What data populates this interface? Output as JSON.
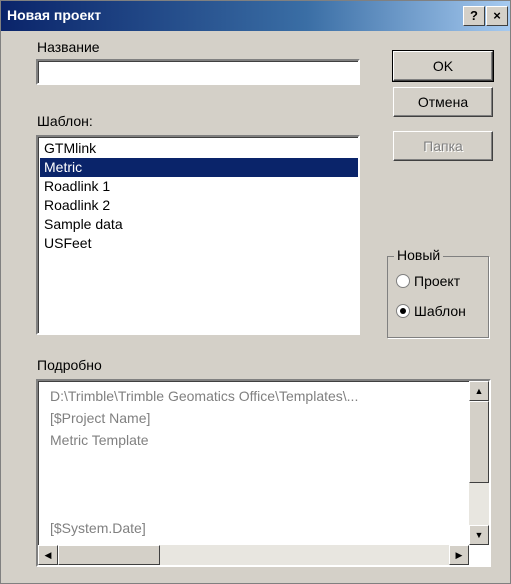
{
  "window": {
    "title": "Новая проект"
  },
  "titlebar_buttons": {
    "help": "?",
    "close": "×"
  },
  "name_label": "Название",
  "name_value": "",
  "template_label": "Шаблон:",
  "templates": [
    "GTMlink",
    "Metric",
    "Roadlink 1",
    "Roadlink 2",
    "Sample data",
    "USFeet"
  ],
  "buttons": {
    "ok": "OK",
    "cancel": "Отмена",
    "folder": "Папка"
  },
  "new_group": {
    "legend": "Новый",
    "options": [
      "Проект",
      "Шаблон"
    ],
    "selected": "Шаблон"
  },
  "details": {
    "label": "Подробно",
    "lines": [
      "D:\\Trimble\\Trimble Geomatics Office\\Templates\\...",
      "[$Project Name]",
      "Metric Template",
      "",
      "",
      "",
      "[$System.Date]"
    ]
  },
  "icons": {
    "radio_on": "radio-selected-icon",
    "radio_off": "radio-icon",
    "up": "scroll-up-arrow-icon",
    "down": "scroll-down-arrow-icon",
    "left": "scroll-left-arrow-icon",
    "right": "scroll-right-arrow-icon"
  }
}
